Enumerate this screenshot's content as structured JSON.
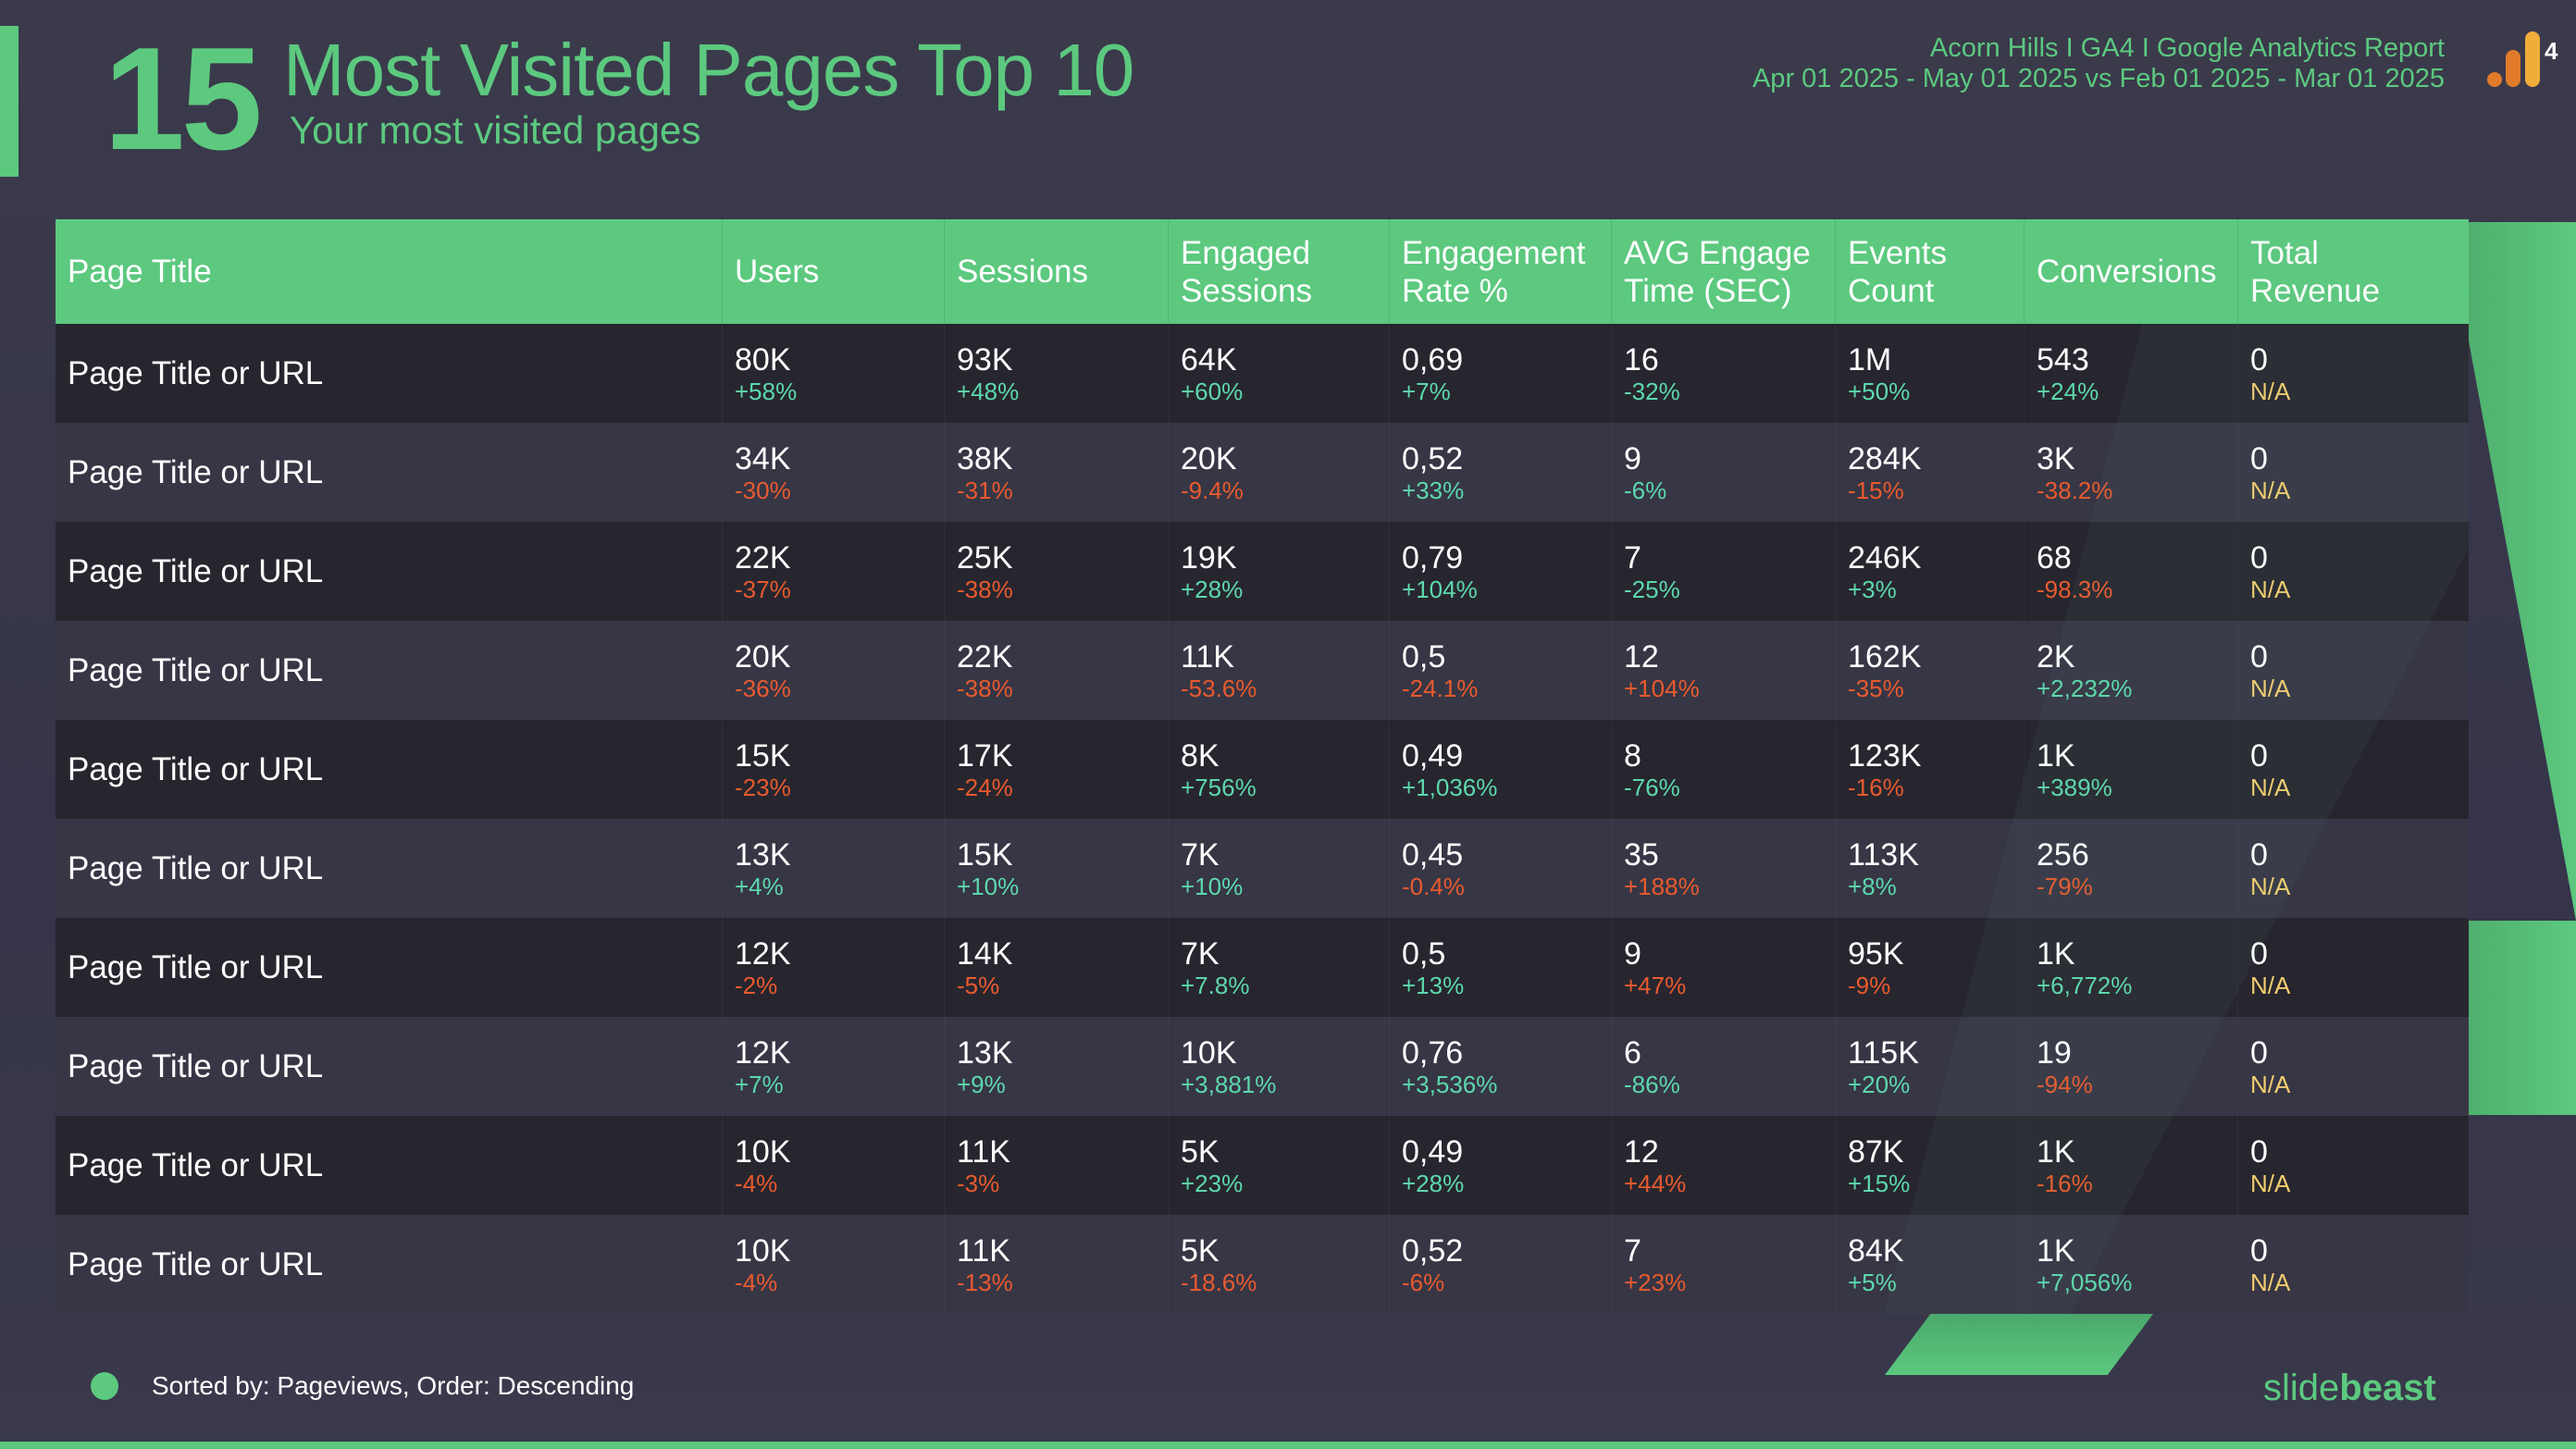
{
  "header": {
    "slide_number": "15",
    "title": "Most Visited Pages Top 10",
    "subtitle": "Your most visited pages",
    "report_name": "Acorn Hills I GA4 I Google Analytics Report",
    "date_range": "Apr 01 2025 - May 01 2025 vs Feb 01 2025 - Mar 01 2025",
    "logo_icon": "ga4-logo-icon",
    "logo_label": "4"
  },
  "colors": {
    "accent": "#5cc97f",
    "positive": "#5dd8ac",
    "negative": "#e95a2e",
    "not_available": "#f2cd6e",
    "background": "#3b3a4b"
  },
  "table": {
    "columns": [
      "Page Title",
      "Users",
      "Sessions",
      "Engaged\nSessions",
      "Engagement\nRate %",
      "AVG Engage\nTime (SEC)",
      "Events\nCount",
      "Conversions",
      "Total\nRevenue"
    ],
    "rows": [
      {
        "page": "Page Title or URL",
        "cells": [
          {
            "v": "80K",
            "c": "+58%",
            "t": "good"
          },
          {
            "v": "93K",
            "c": "+48%",
            "t": "good"
          },
          {
            "v": "64K",
            "c": "+60%",
            "t": "good"
          },
          {
            "v": "0,69",
            "c": "+7%",
            "t": "good"
          },
          {
            "v": "16",
            "c": "-32%",
            "t": "good"
          },
          {
            "v": "1M",
            "c": "+50%",
            "t": "good"
          },
          {
            "v": "543",
            "c": "+24%",
            "t": "good"
          },
          {
            "v": "0",
            "c": "N/A",
            "t": "na"
          }
        ]
      },
      {
        "page": "Page Title or URL",
        "cells": [
          {
            "v": "34K",
            "c": "-30%",
            "t": "bad"
          },
          {
            "v": "38K",
            "c": "-31%",
            "t": "bad"
          },
          {
            "v": "20K",
            "c": "-9.4%",
            "t": "bad"
          },
          {
            "v": "0,52",
            "c": "+33%",
            "t": "good"
          },
          {
            "v": "9",
            "c": "-6%",
            "t": "good"
          },
          {
            "v": "284K",
            "c": "-15%",
            "t": "bad"
          },
          {
            "v": "3K",
            "c": "-38.2%",
            "t": "bad"
          },
          {
            "v": "0",
            "c": "N/A",
            "t": "na"
          }
        ]
      },
      {
        "page": "Page Title or URL",
        "cells": [
          {
            "v": "22K",
            "c": "-37%",
            "t": "bad"
          },
          {
            "v": "25K",
            "c": "-38%",
            "t": "bad"
          },
          {
            "v": "19K",
            "c": "+28%",
            "t": "good"
          },
          {
            "v": "0,79",
            "c": "+104%",
            "t": "good"
          },
          {
            "v": "7",
            "c": "-25%",
            "t": "good"
          },
          {
            "v": "246K",
            "c": "+3%",
            "t": "good"
          },
          {
            "v": "68",
            "c": "-98.3%",
            "t": "bad"
          },
          {
            "v": "0",
            "c": "N/A",
            "t": "na"
          }
        ]
      },
      {
        "page": "Page Title or URL",
        "cells": [
          {
            "v": "20K",
            "c": "-36%",
            "t": "bad"
          },
          {
            "v": "22K",
            "c": "-38%",
            "t": "bad"
          },
          {
            "v": "11K",
            "c": "-53.6%",
            "t": "bad"
          },
          {
            "v": "0,5",
            "c": "-24.1%",
            "t": "bad"
          },
          {
            "v": "12",
            "c": "+104%",
            "t": "bad"
          },
          {
            "v": "162K",
            "c": "-35%",
            "t": "bad"
          },
          {
            "v": "2K",
            "c": "+2,232%",
            "t": "good"
          },
          {
            "v": "0",
            "c": "N/A",
            "t": "na"
          }
        ]
      },
      {
        "page": "Page Title or URL",
        "cells": [
          {
            "v": "15K",
            "c": "-23%",
            "t": "bad"
          },
          {
            "v": "17K",
            "c": "-24%",
            "t": "bad"
          },
          {
            "v": "8K",
            "c": "+756%",
            "t": "good"
          },
          {
            "v": "0,49",
            "c": "+1,036%",
            "t": "good"
          },
          {
            "v": "8",
            "c": "-76%",
            "t": "good"
          },
          {
            "v": "123K",
            "c": "-16%",
            "t": "bad"
          },
          {
            "v": "1K",
            "c": "+389%",
            "t": "good"
          },
          {
            "v": "0",
            "c": "N/A",
            "t": "na"
          }
        ]
      },
      {
        "page": "Page Title or URL",
        "cells": [
          {
            "v": "13K",
            "c": "+4%",
            "t": "good"
          },
          {
            "v": "15K",
            "c": "+10%",
            "t": "good"
          },
          {
            "v": "7K",
            "c": "+10%",
            "t": "good"
          },
          {
            "v": "0,45",
            "c": "-0.4%",
            "t": "bad"
          },
          {
            "v": "35",
            "c": "+188%",
            "t": "bad"
          },
          {
            "v": "113K",
            "c": "+8%",
            "t": "good"
          },
          {
            "v": "256",
            "c": "-79%",
            "t": "bad"
          },
          {
            "v": "0",
            "c": "N/A",
            "t": "na"
          }
        ]
      },
      {
        "page": "Page Title or URL",
        "cells": [
          {
            "v": "12K",
            "c": "-2%",
            "t": "bad"
          },
          {
            "v": "14K",
            "c": "-5%",
            "t": "bad"
          },
          {
            "v": "7K",
            "c": "+7.8%",
            "t": "good"
          },
          {
            "v": "0,5",
            "c": "+13%",
            "t": "good"
          },
          {
            "v": "9",
            "c": "+47%",
            "t": "bad"
          },
          {
            "v": "95K",
            "c": "-9%",
            "t": "bad"
          },
          {
            "v": "1K",
            "c": "+6,772%",
            "t": "good"
          },
          {
            "v": "0",
            "c": "N/A",
            "t": "na"
          }
        ]
      },
      {
        "page": "Page Title or URL",
        "cells": [
          {
            "v": "12K",
            "c": "+7%",
            "t": "good"
          },
          {
            "v": "13K",
            "c": "+9%",
            "t": "good"
          },
          {
            "v": "10K",
            "c": "+3,881%",
            "t": "good"
          },
          {
            "v": "0,76",
            "c": "+3,536%",
            "t": "good"
          },
          {
            "v": "6",
            "c": "-86%",
            "t": "good"
          },
          {
            "v": "115K",
            "c": "+20%",
            "t": "good"
          },
          {
            "v": "19",
            "c": "-94%",
            "t": "bad"
          },
          {
            "v": "0",
            "c": "N/A",
            "t": "na"
          }
        ]
      },
      {
        "page": "Page Title or URL",
        "cells": [
          {
            "v": "10K",
            "c": "-4%",
            "t": "bad"
          },
          {
            "v": "11K",
            "c": "-3%",
            "t": "bad"
          },
          {
            "v": "5K",
            "c": "+23%",
            "t": "good"
          },
          {
            "v": "0,49",
            "c": "+28%",
            "t": "good"
          },
          {
            "v": "12",
            "c": "+44%",
            "t": "bad"
          },
          {
            "v": "87K",
            "c": "+15%",
            "t": "good"
          },
          {
            "v": "1K",
            "c": "-16%",
            "t": "bad"
          },
          {
            "v": "0",
            "c": "N/A",
            "t": "na"
          }
        ]
      },
      {
        "page": "Page Title or URL",
        "cells": [
          {
            "v": "10K",
            "c": "-4%",
            "t": "bad"
          },
          {
            "v": "11K",
            "c": "-13%",
            "t": "bad"
          },
          {
            "v": "5K",
            "c": "-18.6%",
            "t": "bad"
          },
          {
            "v": "0,52",
            "c": "-6%",
            "t": "bad"
          },
          {
            "v": "7",
            "c": "+23%",
            "t": "bad"
          },
          {
            "v": "84K",
            "c": "+5%",
            "t": "good"
          },
          {
            "v": "1K",
            "c": "+7,056%",
            "t": "good"
          },
          {
            "v": "0",
            "c": "N/A",
            "t": "na"
          }
        ]
      }
    ]
  },
  "footer": {
    "sort_note": "Sorted by: Pageviews, Order: Descending",
    "brand_light": "slide",
    "brand_bold": "beast"
  }
}
